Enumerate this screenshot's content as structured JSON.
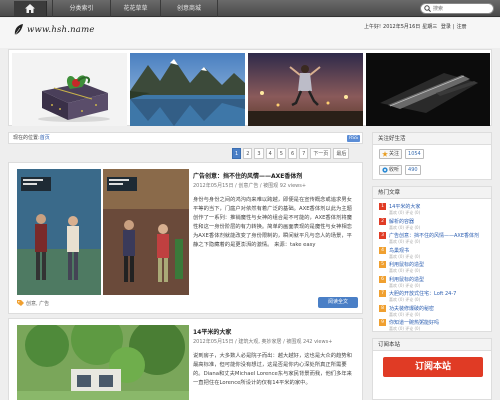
{
  "nav": {
    "items": [
      "分类索引",
      "花花草草",
      "创意商城"
    ]
  },
  "search": {
    "placeholder": "搜索",
    "value": ""
  },
  "header": {
    "logo_text": "www.hsh.name",
    "date_prefix": "上午好!",
    "date": "2012年5月16日",
    "weekday": "星期三",
    "login": "登录",
    "register": "注册"
  },
  "breadcrumb": {
    "label": "现在的位置:",
    "current": "首页",
    "rss": "RSS"
  },
  "pager": {
    "pages": [
      "1",
      "2",
      "3",
      "4",
      "5",
      "6",
      "7"
    ],
    "next": "下一页",
    "last": "最后",
    "current": "1"
  },
  "posts": [
    {
      "title": "广告创意：挡不住的风情——AXE香体剂",
      "meta": "2012年05月15日 / 创意广告 / 被围观 92 views+",
      "excerpt": "身份与身份之间的鸿沟向来难以跨越，即便是在宣传概念或追求男女平等的当下，门庭户对依然有着广泛的基础。AXE香体剂以此为主题创作了一系列：推销魔性与女神的组合是不可能的，AXE香体剂将魔性和这一身份阶层的有力转换。简单的画面表现的是魔性与女神相恋为AXE香体剂就能改变了身份限制的，瞬间就平凡与恋人的场景，平静之下隐藏着的是更澎湃的激情。 来源：take easy",
      "tags": "创意, 广告",
      "readmore": "阅读全文"
    },
    {
      "title": "14平米的大家",
      "meta": "2012年05月15日 / 建筑大观, 奥妙家居 / 被围观 242 views+",
      "excerpt": "说到房子，大多数人必是院子而出：越大越好，这也是大众的趋势和最高标准，但可能你没有想过，这是否是你内心深处所真正所需要的。Diana和丈夫Michael Lorence东与家民背景而我，他们多年来一直把住在Lorence所设计的仅有14平米的家中。"
    }
  ],
  "sidebar": {
    "follow": {
      "title": "关注好生活",
      "rows": [
        {
          "button": "关注",
          "count": "1054"
        },
        {
          "button": "收听",
          "count": "490"
        }
      ]
    },
    "hot": {
      "title": "热门文章",
      "items": [
        {
          "num": "1",
          "title": "14平米的大家",
          "sub": "喜欢 (0) 评论 (0)"
        },
        {
          "num": "2",
          "title": "解析的容器",
          "sub": "喜欢 (0) 评论 (0)"
        },
        {
          "num": "3",
          "title": "广告创意：挡不住的风情——AXE香体剂",
          "sub": "喜欢 (0) 评论 (0)"
        },
        {
          "num": "4",
          "title": "鸟巢观书",
          "sub": "喜欢 (0) 评论 (0)"
        },
        {
          "num": "5",
          "title": "利用鼠标的造型",
          "sub": "喜欢 (0) 评论 (0)"
        },
        {
          "num": "6",
          "title": "利用鼠标的造型",
          "sub": "喜欢 (0) 评论 (0)"
        },
        {
          "num": "7",
          "title": "大胆的开放式住宅：Loft 24-7",
          "sub": "喜欢 (0) 评论 (0)"
        },
        {
          "num": "8",
          "title": "功夫装修爆破的秘密",
          "sub": "喜欢 (0) 评论 (0)"
        },
        {
          "num": "9",
          "title": "你知道一碗热粥能好吗",
          "sub": "喜欢 (0) 评论 (0)"
        }
      ]
    },
    "subscribe": {
      "title": "订阅本站",
      "banner": "订阅本站"
    }
  },
  "colors": {
    "accent": "#4a7fc6",
    "hot_red": "#e03b25",
    "hot_orange": "#f0a030"
  }
}
